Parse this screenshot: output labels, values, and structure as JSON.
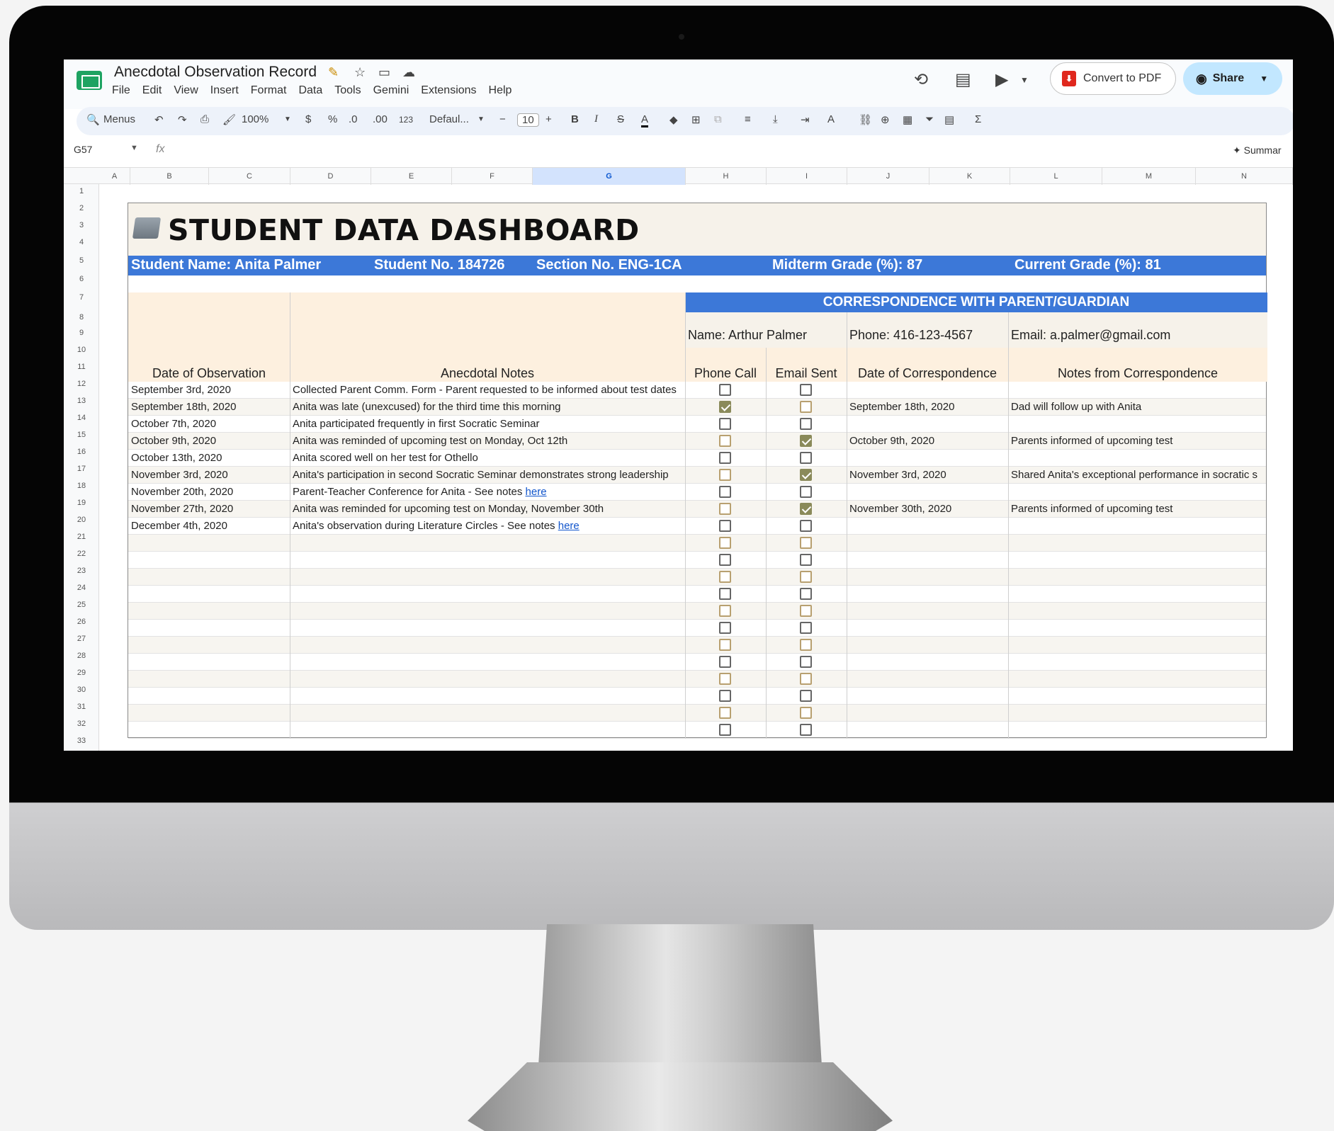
{
  "doc": {
    "title": "Anecdotal Observation Record",
    "menus": [
      "File",
      "Edit",
      "View",
      "Insert",
      "Format",
      "Data",
      "Tools",
      "Gemini",
      "Extensions",
      "Help"
    ],
    "convert_label": "Convert to PDF",
    "share_label": "Share"
  },
  "toolbar": {
    "search": "Menus",
    "zoom": "100%",
    "currency": "$",
    "percent": "%",
    "dec_less": ".0",
    "dec_more": ".00",
    "format123": "123",
    "font": "Defaul...",
    "font_size": "10"
  },
  "formula": {
    "cell_ref": "G57",
    "fx": "fx",
    "summary": "✦ Summar"
  },
  "columns": [
    "A",
    "B",
    "C",
    "D",
    "E",
    "F",
    "G",
    "H",
    "I",
    "J",
    "K",
    "L",
    "M",
    "N"
  ],
  "rows": [
    "1",
    "2",
    "3",
    "4",
    "5",
    "6",
    "7",
    "8",
    "9",
    "10",
    "11",
    "12",
    "13",
    "14",
    "15",
    "16",
    "17",
    "18",
    "19",
    "20",
    "21",
    "22",
    "23",
    "24",
    "25",
    "26",
    "27",
    "28",
    "29",
    "30",
    "31",
    "32",
    "33"
  ],
  "dashboard": {
    "title": "STUDENT DATA DASHBOARD",
    "student_name": "Student Name: Anita Palmer",
    "student_no": "Student No. 184726",
    "section": "Section No. ENG-1CA",
    "midterm": "Midterm Grade (%): 87",
    "current": "Current Grade (%): 81",
    "corr_header": "CORRESPONDENCE WITH PARENT/GUARDIAN",
    "parent_name": "Name: Arthur Palmer",
    "parent_phone": "Phone: 416-123-4567",
    "parent_email": "Email: a.palmer@gmail.com",
    "headers": {
      "date": "Date of Observation",
      "notes": "Anecdotal Notes",
      "phone": "Phone Call",
      "email": "Email Sent",
      "corr_date": "Date of Correspondence",
      "corr_notes": "Notes from Correspondence"
    },
    "entries": [
      {
        "date": "September 3rd, 2020",
        "note": "Collected Parent Comm. Form - Parent requested to be informed about test dates",
        "link": "",
        "phone": false,
        "email": false,
        "corr_date": "",
        "corr_note": ""
      },
      {
        "date": "September 18th, 2020",
        "note": "Anita was late (unexcused) for the third time this morning",
        "link": "",
        "phone": true,
        "email": false,
        "corr_date": "September 18th, 2020",
        "corr_note": "Dad will follow up with Anita"
      },
      {
        "date": "October 7th, 2020",
        "note": "Anita participated frequently in first Socratic Seminar",
        "link": "",
        "phone": false,
        "email": false,
        "corr_date": "",
        "corr_note": ""
      },
      {
        "date": "October 9th, 2020",
        "note": "Anita was reminded of upcoming test on Monday, Oct 12th",
        "link": "",
        "phone": false,
        "email": true,
        "corr_date": "October 9th, 2020",
        "corr_note": "Parents informed of upcoming test"
      },
      {
        "date": "October 13th, 2020",
        "note": "Anita scored well on her test for Othello",
        "link": "",
        "phone": false,
        "email": false,
        "corr_date": "",
        "corr_note": ""
      },
      {
        "date": "November 3rd, 2020",
        "note": "Anita's participation in second Socratic Seminar demonstrates strong leadership",
        "link": "",
        "phone": false,
        "email": true,
        "corr_date": "November 3rd, 2020",
        "corr_note": "Shared Anita's exceptional performance in socratic s"
      },
      {
        "date": "November 20th, 2020",
        "note": "Parent-Teacher Conference for Anita - See notes ",
        "link": "here",
        "phone": false,
        "email": false,
        "corr_date": "",
        "corr_note": ""
      },
      {
        "date": "November 27th, 2020",
        "note": "Anita was reminded for upcoming test on Monday, November 30th",
        "link": "",
        "phone": false,
        "email": true,
        "corr_date": "November 30th, 2020",
        "corr_note": "Parents informed of upcoming test"
      },
      {
        "date": "December 4th, 2020",
        "note": "Anita's observation during Literature Circles - See notes ",
        "link": "here",
        "phone": false,
        "email": false,
        "corr_date": "",
        "corr_note": ""
      }
    ],
    "empty_rows": 12
  }
}
